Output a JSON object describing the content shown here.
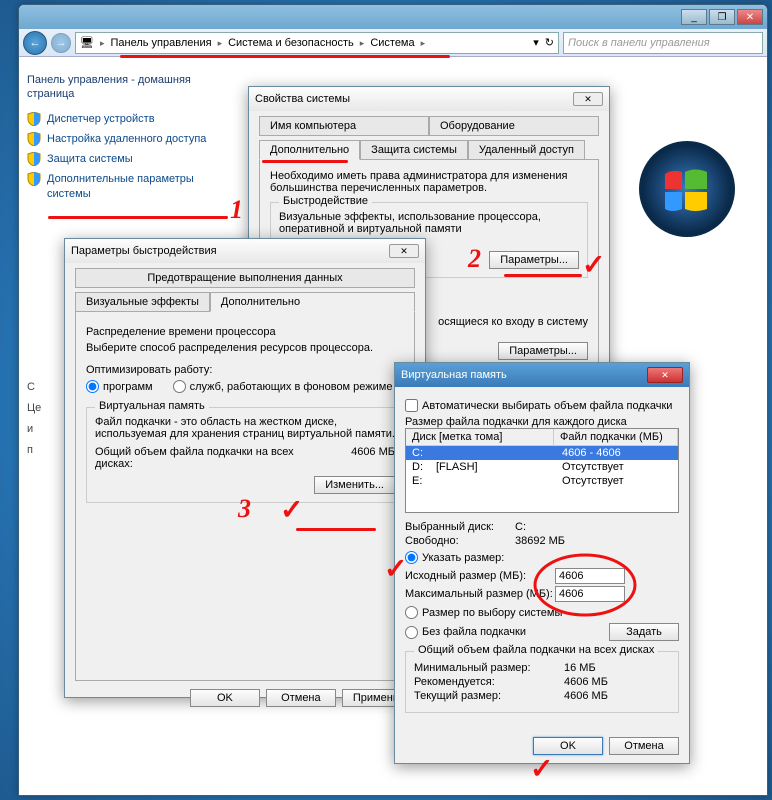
{
  "titlebar": {
    "min": "_",
    "max": "❐",
    "close": "✕"
  },
  "address": {
    "items": [
      "Панель управления",
      "Система и безопасность",
      "Система"
    ],
    "search_placeholder": "Поиск в панели управления"
  },
  "sidebar": {
    "title": "Панель управления - домашняя страница",
    "links": [
      "Диспетчер устройств",
      "Настройка удаленного доступа",
      "Защита системы",
      "Дополнительные параметры системы"
    ],
    "cut": [
      "С",
      "Це",
      "и",
      "п"
    ]
  },
  "sys_props": {
    "title": "Свойства системы",
    "tabs_row1": [
      "Имя компьютера",
      "Оборудование"
    ],
    "tabs_row2": [
      "Дополнительно",
      "Защита системы",
      "Удаленный доступ"
    ],
    "intro": "Необходимо иметь права администратора для изменения большинства перечисленных параметров.",
    "perf_title": "Быстродействие",
    "perf_text": "Визуальные эффекты, использование процессора, оперативной и виртуальной памяти",
    "perf_btn": "Параметры...",
    "profiles_text": "осящиеся ко входу в систему",
    "profiles_btn": "Параметры..."
  },
  "perf_opts": {
    "title": "Параметры быстродействия",
    "tabs_row1": [
      "Предотвращение выполнения данных"
    ],
    "tabs_row2": [
      "Визуальные эффекты",
      "Дополнительно"
    ],
    "sched_title": "Распределение времени процессора",
    "sched_text": "Выберите способ распределения ресурсов процессора.",
    "opt_label": "Оптимизировать работу:",
    "opt_programs": "программ",
    "opt_services": "служб, работающих в фоновом режиме",
    "vm_title": "Виртуальная память",
    "vm_desc": "Файл подкачки - это область на жестком диске, используемая для хранения страниц виртуальной памяти.",
    "vm_total_label": "Общий объем файла подкачки на всех дисках:",
    "vm_total_value": "4606 МБ",
    "vm_change_btn": "Изменить...",
    "ok": "OK",
    "cancel": "Отмена",
    "apply": "Применит"
  },
  "vm": {
    "title": "Виртуальная память",
    "auto": "Автоматически выбирать объем файла подкачки",
    "size_label": "Размер файла подкачки для каждого диска",
    "col_disk": "Диск [метка тома]",
    "col_file": "Файл подкачки (МБ)",
    "rows": [
      {
        "d": "C:",
        "l": "",
        "v": "4606 - 4606"
      },
      {
        "d": "D:",
        "l": "[FLASH]",
        "v": "Отсутствует"
      },
      {
        "d": "E:",
        "l": "",
        "v": "Отсутствует"
      }
    ],
    "sel_disk_label": "Выбранный диск:",
    "sel_disk": "C:",
    "free_label": "Свободно:",
    "free": "38692 МБ",
    "custom": "Указать размер:",
    "init_label": "Исходный размер (МБ):",
    "init_val": "4606",
    "max_label": "Максимальный размер (МБ):",
    "max_val": "4606",
    "sys_managed": "Размер по выбору системы",
    "no_file": "Без файла подкачки",
    "set_btn": "Задать",
    "total_title": "Общий объем файла подкачки на всех дисках",
    "min_label": "Минимальный размер:",
    "min": "16 МБ",
    "rec_label": "Рекомендуется:",
    "rec": "4606 МБ",
    "cur_label": "Текущий размер:",
    "cur": "4606 МБ",
    "ok": "OK",
    "cancel": "Отмена"
  }
}
